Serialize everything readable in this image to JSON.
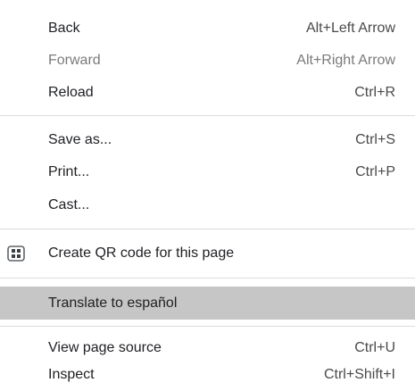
{
  "menu": {
    "back": {
      "label": "Back",
      "shortcut": "Alt+Left Arrow"
    },
    "forward": {
      "label": "Forward",
      "shortcut": "Alt+Right Arrow"
    },
    "reload": {
      "label": "Reload",
      "shortcut": "Ctrl+R"
    },
    "save_as": {
      "label": "Save as...",
      "shortcut": "Ctrl+S"
    },
    "print": {
      "label": "Print...",
      "shortcut": "Ctrl+P"
    },
    "cast": {
      "label": "Cast..."
    },
    "qr_code": {
      "label": "Create QR code for this page",
      "icon": "qr-code-icon"
    },
    "translate": {
      "label": "Translate to español"
    },
    "view_source": {
      "label": "View page source",
      "shortcut": "Ctrl+U"
    },
    "inspect": {
      "label": "Inspect",
      "shortcut": "Ctrl+Shift+I"
    }
  },
  "colors": {
    "highlight": "#c6c6c6",
    "disabled_text": "#7a7a7a",
    "divider": "#dadce0"
  }
}
